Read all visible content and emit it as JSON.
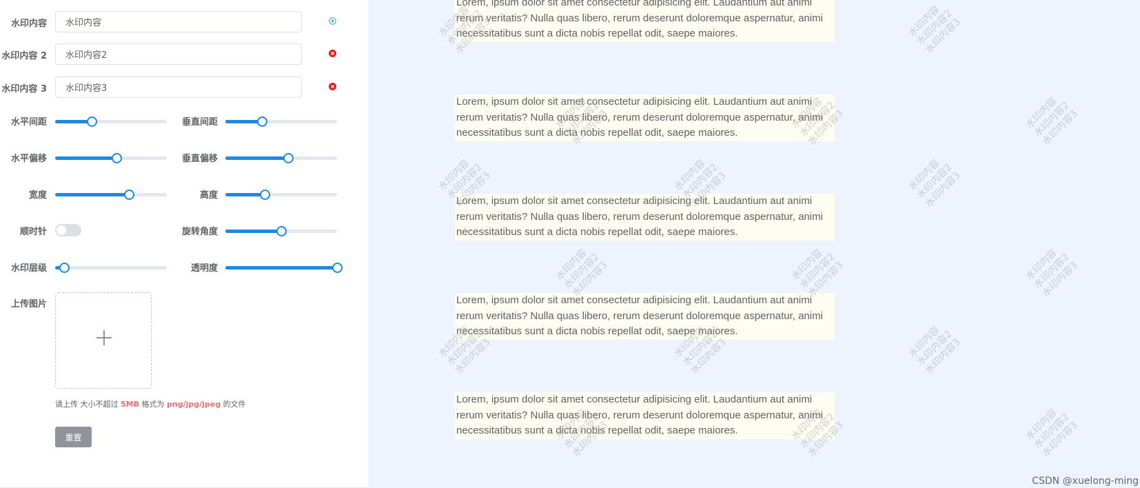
{
  "form": {
    "content1": {
      "label": "水印内容",
      "value": "水印内容"
    },
    "content2": {
      "label": "水印内容 2",
      "value": "水印内容2"
    },
    "content3": {
      "label": "水印内容 3",
      "value": "水印内容3"
    },
    "gap_x": {
      "label": "水平间距",
      "value": 0.33
    },
    "gap_y": {
      "label": "垂直间距",
      "value": 0.33
    },
    "offset_x": {
      "label": "水平偏移",
      "value": 0.55
    },
    "offset_y": {
      "label": "垂直偏移",
      "value": 0.56
    },
    "width": {
      "label": "宽度",
      "value": 0.66
    },
    "height": {
      "label": "高度",
      "value": 0.35
    },
    "clockwise": {
      "label": "顺时针",
      "on": false
    },
    "rotate": {
      "label": "旋转角度",
      "value": 0.5
    },
    "zindex": {
      "label": "水印层级",
      "value": 0.08
    },
    "opacity": {
      "label": "透明度",
      "value": 1.0
    },
    "upload": {
      "label": "上传图片",
      "tip_prefix": "请上传 大小不超过",
      "tip_size": "5MB",
      "tip_mid": "格式为",
      "tip_formats": "png/jpg/jpeg",
      "tip_suffix": "的文件"
    },
    "reset_label": "重置"
  },
  "preview": {
    "paragraph": "Lorem, ipsum dolor sit amet consectetur adipisicing elit. Laudantium aut animi rerum veritatis? Nulla quas libero, rerum deserunt doloremque aspernatur, animi necessitatibus sunt a dicta nobis repellat odit, saepe maiores.",
    "watermark_lines": [
      "水印内容",
      "水印内容2",
      "水印内容3"
    ]
  },
  "credit": "CSDN @xuelong-ming",
  "colors": {
    "accent": "#1e88e5",
    "danger": "#f56c6c",
    "preview_bg": "#edf4fe",
    "paragraph_bg": "#fefdf1"
  }
}
